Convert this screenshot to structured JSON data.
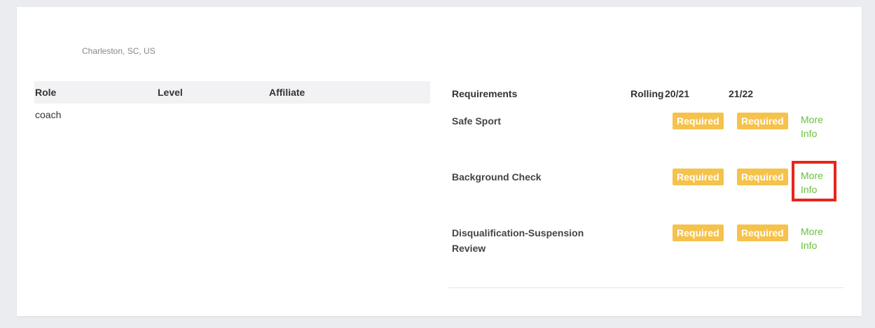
{
  "profile": {
    "location": "Charleston, SC, US"
  },
  "roles_table": {
    "headers": [
      "Role",
      "Level",
      "Affiliate"
    ],
    "rows": [
      {
        "role": "coach",
        "level": "",
        "affiliate": ""
      }
    ]
  },
  "requirements_table": {
    "headers": [
      "Requirements",
      "Rolling",
      "20/21",
      "21/22"
    ],
    "rows": [
      {
        "name": "Safe Sport",
        "status_2021": "Required",
        "status_2122": "Required",
        "more_info": "More Info"
      },
      {
        "name": "Background Check",
        "status_2021": "Required",
        "status_2122": "Required",
        "more_info": "More Info"
      },
      {
        "name": "Disqualification-Suspension Review",
        "status_2021": "Required",
        "status_2122": "Required",
        "more_info": "More Info"
      }
    ]
  },
  "colors": {
    "required_badge": "#f5c24c",
    "link": "#6abf3c",
    "highlight": "#e8251b"
  }
}
